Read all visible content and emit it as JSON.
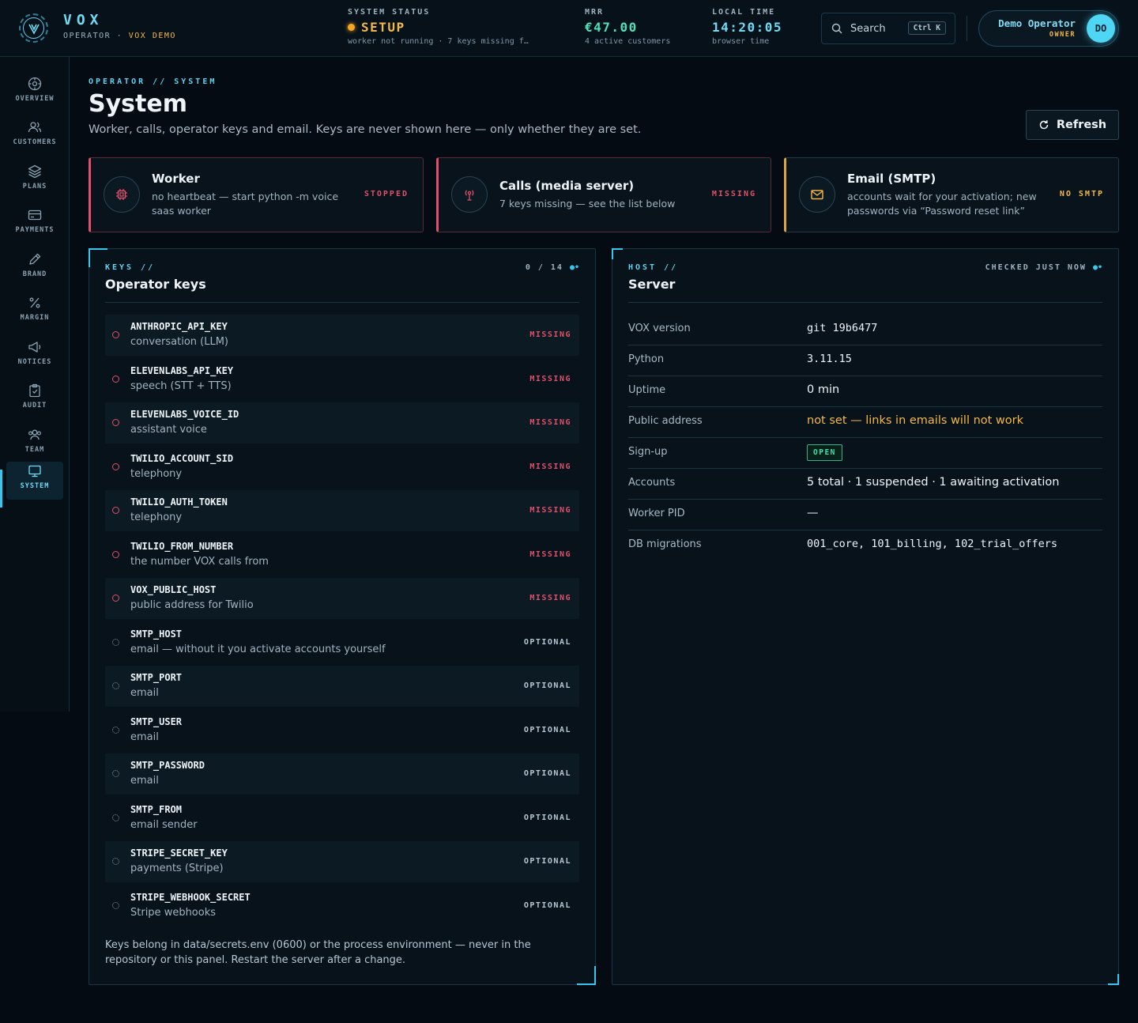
{
  "brand": {
    "name": "VOX",
    "sub_prefix": "OPERATOR ·",
    "sub_accent": "VOX DEMO"
  },
  "header": {
    "system_status": {
      "label": "SYSTEM STATUS",
      "value": "SETUP",
      "sub": "worker not running · 7 keys missing f…"
    },
    "mrr": {
      "label": "MRR",
      "value": "€47.00",
      "sub": "4 active customers"
    },
    "local_time": {
      "label": "LOCAL TIME",
      "value": "14:20:05",
      "sub": "browser time"
    },
    "search": {
      "label": "Search",
      "shortcut": "Ctrl K"
    },
    "user": {
      "name": "Demo Operator",
      "role": "OWNER",
      "initials": "DO"
    }
  },
  "sidebar": {
    "items": [
      {
        "label": "OVERVIEW",
        "icon": "compass-icon"
      },
      {
        "label": "CUSTOMERS",
        "icon": "users-icon"
      },
      {
        "label": "PLANS",
        "icon": "layers-icon"
      },
      {
        "label": "PAYMENTS",
        "icon": "credit-card-icon"
      },
      {
        "label": "BRAND",
        "icon": "pen-icon"
      },
      {
        "label": "MARGIN",
        "icon": "percent-icon"
      },
      {
        "label": "NOTICES",
        "icon": "megaphone-icon"
      },
      {
        "label": "AUDIT",
        "icon": "clipboard-icon"
      },
      {
        "label": "TEAM",
        "icon": "team-icon"
      },
      {
        "label": "SYSTEM",
        "icon": "monitor-icon",
        "active": true
      }
    ]
  },
  "page": {
    "breadcrumb": "OPERATOR // SYSTEM",
    "title": "System",
    "subtitle": "Worker, calls, operator keys and email. Keys are never shown here — only whether they are set.",
    "refresh_label": "Refresh"
  },
  "status_cards": [
    {
      "title": "Worker",
      "desc_line1": "no heartbeat — start python -m voice",
      "desc_line2": "saas worker",
      "badge": "STOPPED",
      "icon": "cpu-icon",
      "color": "#e0506a"
    },
    {
      "title": "Calls (media server)",
      "desc_line1": "7 keys missing — see the list below",
      "desc_line2": "",
      "badge": "MISSING",
      "icon": "antenna-icon",
      "color": "#e0506a"
    },
    {
      "title": "Email (SMTP)",
      "desc_line1": "accounts wait for your activation; new",
      "desc_line2": "passwords via “Password reset link”",
      "badge": "NO SMTP",
      "icon": "mail-icon",
      "color": "#f5b847"
    }
  ],
  "keys_panel": {
    "kicker": "KEYS //",
    "title": "Operator keys",
    "count": "0 / 14",
    "keys": [
      {
        "name": "ANTHROPIC_API_KEY",
        "desc": "conversation (LLM)",
        "status": "MISSING"
      },
      {
        "name": "ELEVENLABS_API_KEY",
        "desc": "speech (STT + TTS)",
        "status": "MISSING"
      },
      {
        "name": "ELEVENLABS_VOICE_ID",
        "desc": "assistant voice",
        "status": "MISSING"
      },
      {
        "name": "TWILIO_ACCOUNT_SID",
        "desc": "telephony",
        "status": "MISSING"
      },
      {
        "name": "TWILIO_AUTH_TOKEN",
        "desc": "telephony",
        "status": "MISSING"
      },
      {
        "name": "TWILIO_FROM_NUMBER",
        "desc": "the number VOX calls from",
        "status": "MISSING"
      },
      {
        "name": "VOX_PUBLIC_HOST",
        "desc": "public address for Twilio",
        "status": "MISSING"
      },
      {
        "name": "SMTP_HOST",
        "desc": "email — without it you activate accounts yourself",
        "status": "OPTIONAL"
      },
      {
        "name": "SMTP_PORT",
        "desc": "email",
        "status": "OPTIONAL"
      },
      {
        "name": "SMTP_USER",
        "desc": "email",
        "status": "OPTIONAL"
      },
      {
        "name": "SMTP_PASSWORD",
        "desc": "email",
        "status": "OPTIONAL"
      },
      {
        "name": "SMTP_FROM",
        "desc": "email sender",
        "status": "OPTIONAL"
      },
      {
        "name": "STRIPE_SECRET_KEY",
        "desc": "payments (Stripe)",
        "status": "OPTIONAL"
      },
      {
        "name": "STRIPE_WEBHOOK_SECRET",
        "desc": "Stripe webhooks",
        "status": "OPTIONAL"
      }
    ],
    "footer_line1": "Keys belong in data/secrets.env (0600) or the process environment — never in the",
    "footer_line2": "repository or this panel. Restart the server after a change."
  },
  "server_panel": {
    "kicker": "HOST //",
    "title": "Server",
    "meta": "CHECKED JUST NOW",
    "rows": [
      {
        "label": "VOX version",
        "value": "git 19b6477",
        "style": "mono-val"
      },
      {
        "label": "Python",
        "value": "3.11.15",
        "style": "mono-val"
      },
      {
        "label": "Uptime",
        "value": "0 min",
        "style": ""
      },
      {
        "label": "Public address",
        "value": "not set — links in emails will not work",
        "style": "warn"
      },
      {
        "label": "Sign-up",
        "value": "OPEN",
        "style": "badge"
      },
      {
        "label": "Accounts",
        "value": "5 total · 1 suspended · 1 awaiting activation",
        "style": ""
      },
      {
        "label": "Worker PID",
        "value": "—",
        "style": ""
      },
      {
        "label": "DB migrations",
        "value": "001_core, 101_billing, 102_trial_offers",
        "style": "mono-val"
      }
    ]
  }
}
